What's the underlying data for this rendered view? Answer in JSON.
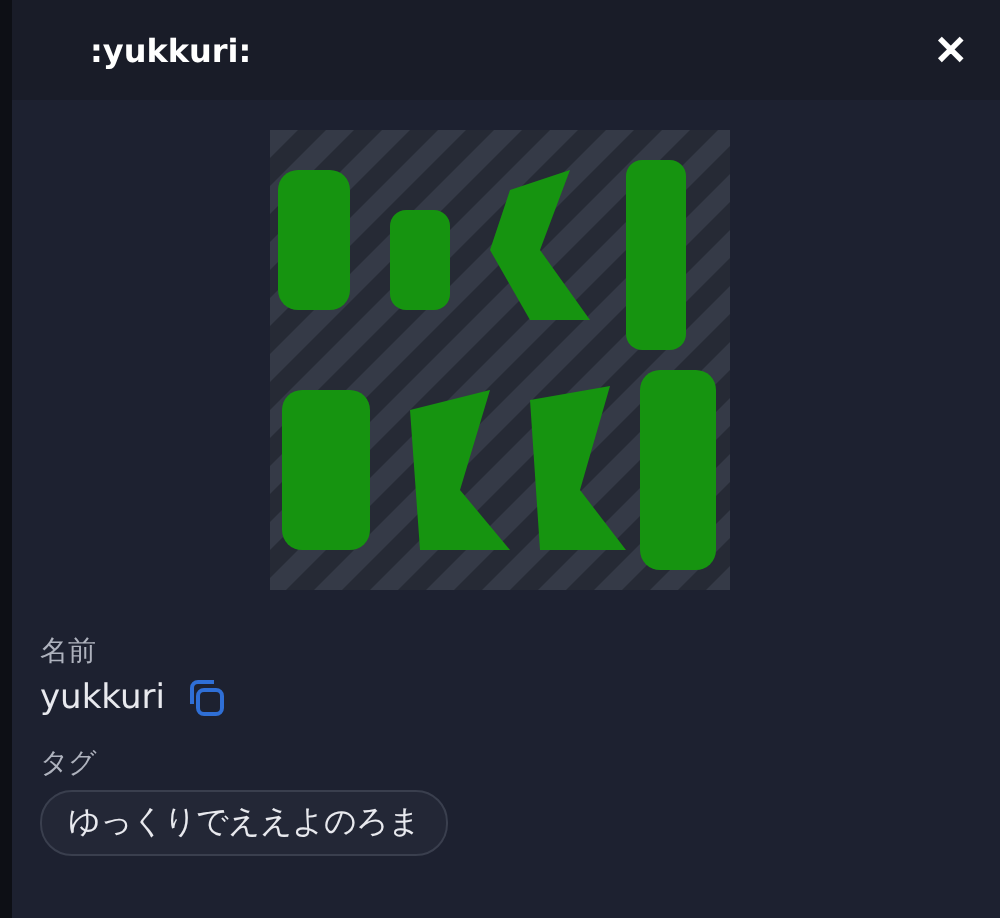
{
  "dialog": {
    "title": ":yukkuri:",
    "close": "✕"
  },
  "fields": [
    {
      "kind": "name",
      "label": "名前",
      "value": "yukkuri"
    },
    {
      "kind": "tags",
      "label": "タグ",
      "tags": [
        "ゆっくりでええよのろま"
      ]
    }
  ]
}
